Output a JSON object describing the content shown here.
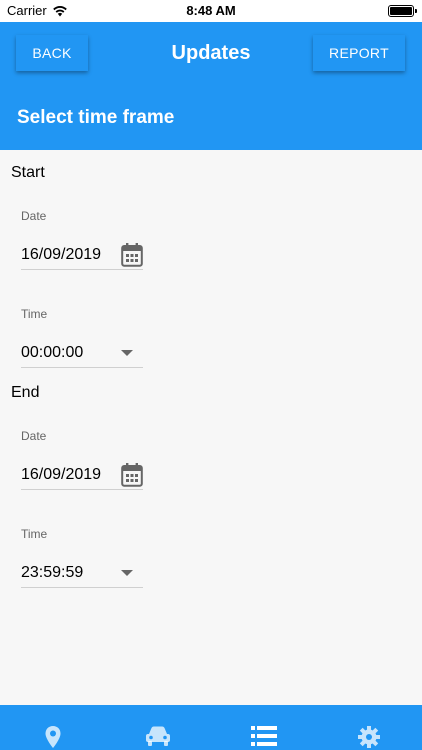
{
  "status_bar": {
    "carrier": "Carrier",
    "time": "8:48 AM"
  },
  "header": {
    "back_label": "BACK",
    "title": "Updates",
    "report_label": "REPORT",
    "subtitle": "Select time frame"
  },
  "start": {
    "label": "Start",
    "date_label": "Date",
    "date_value": "16/09/2019",
    "time_label": "Time",
    "time_value": "00:00:00"
  },
  "end": {
    "label": "End",
    "date_label": "Date",
    "date_value": "16/09/2019",
    "time_label": "Time",
    "time_value": "23:59:59"
  },
  "bottom_nav": {
    "items": [
      "map-pin-icon",
      "car-icon",
      "list-icon",
      "gear-icon"
    ]
  },
  "colors": {
    "primary": "#2196f3",
    "background": "#f7f7f7"
  }
}
